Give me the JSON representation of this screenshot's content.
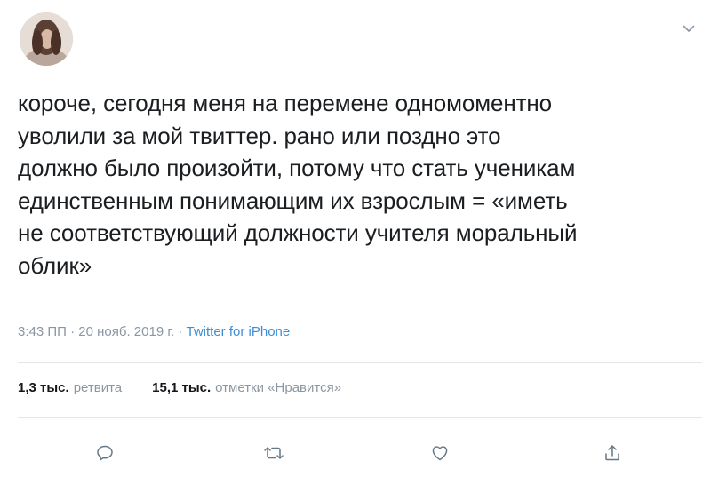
{
  "tweet": {
    "text": "короче, сегодня меня на перемене одномоментно\nуволили за мой твиттер. рано или поздно это\nдолжно было произойти, потому что стать ученикам\nединственным понимающим их взрослым = «иметь\nне соответствующий должности учителя моральный\nоблик»",
    "time": "3:43 ПП",
    "date": "20 нояб. 2019 г.",
    "separator": "·",
    "source": "Twitter for iPhone"
  },
  "stats": {
    "retweets_count": "1,3 тыс.",
    "retweets_label": "ретвита",
    "likes_count": "15,1 тыс.",
    "likes_label": "отметки «Нравится»"
  },
  "icons": {
    "menu": "chevron-down-icon",
    "reply": "reply-icon",
    "retweet": "retweet-icon",
    "like": "heart-icon",
    "share": "share-icon"
  },
  "colors": {
    "text": "#1b1e21",
    "meta": "#8a97a3",
    "link": "#3b8fd6",
    "icon": "#657786",
    "divider": "#e3e8ec"
  }
}
